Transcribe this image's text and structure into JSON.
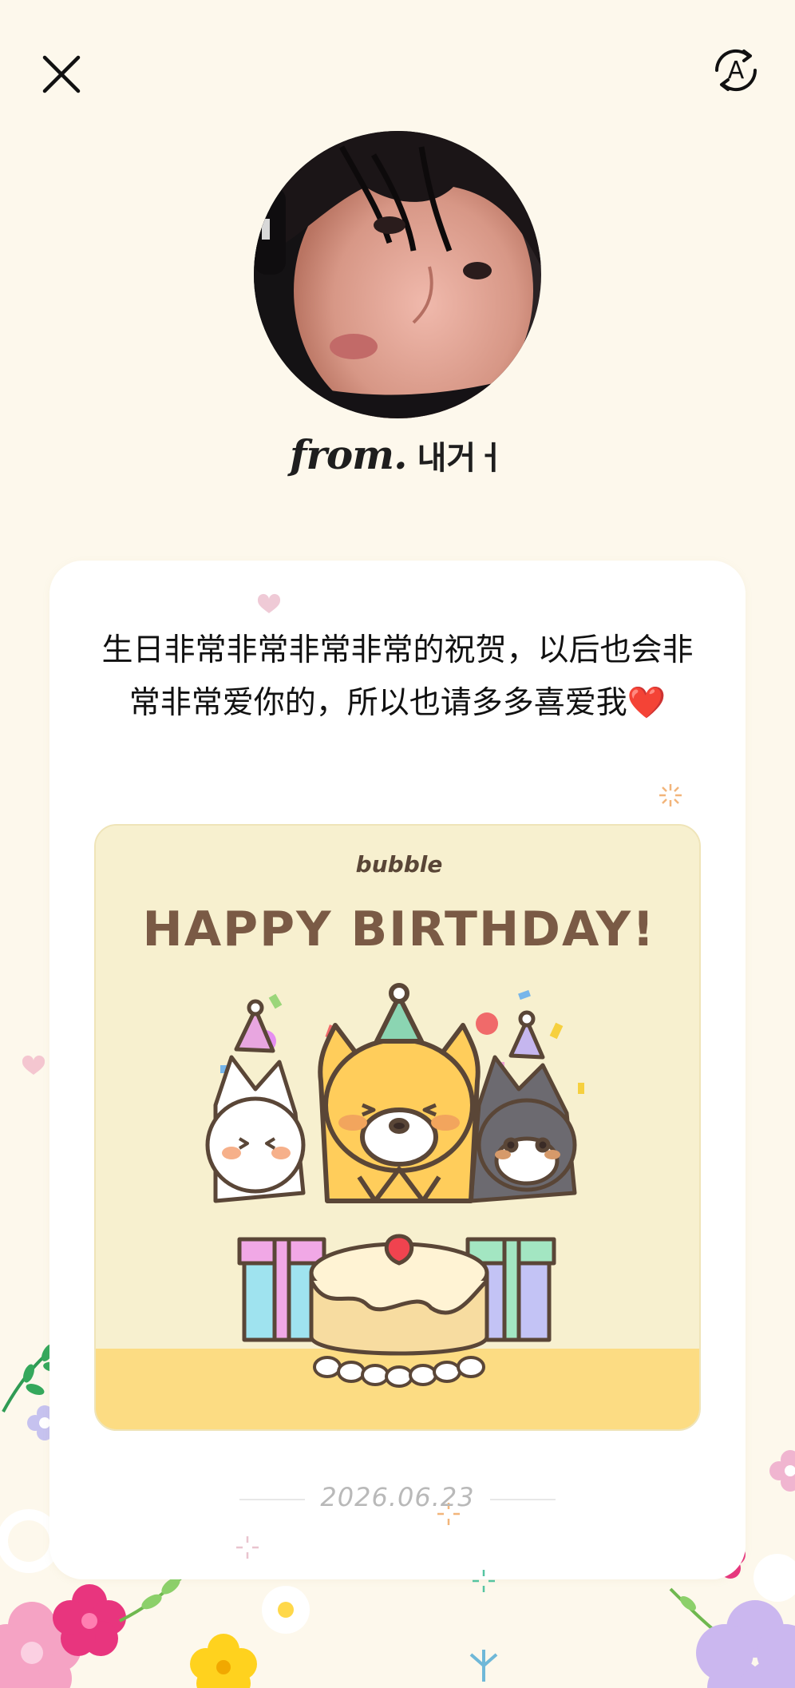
{
  "header": {
    "close_icon": "close-icon",
    "translate_icon": "translate-icon",
    "translate_glyph": "A"
  },
  "profile": {
    "from_label": "from.",
    "sender_name": "내거ㅓ"
  },
  "letter": {
    "message": "生日非常非常非常非常的祝贺，以后也会非常非常爱你的，所以也请多多喜爱我❤️",
    "image": {
      "brand": "bubble",
      "headline": "HAPPY BIRTHDAY!"
    },
    "date": "2026.06.23"
  },
  "colors": {
    "page_background": "#fdf8ec",
    "card_background": "#ffffff",
    "image_background": "#f7f0cf",
    "headline_brown": "#7a5a45",
    "date_gray": "#b9b9b9"
  }
}
